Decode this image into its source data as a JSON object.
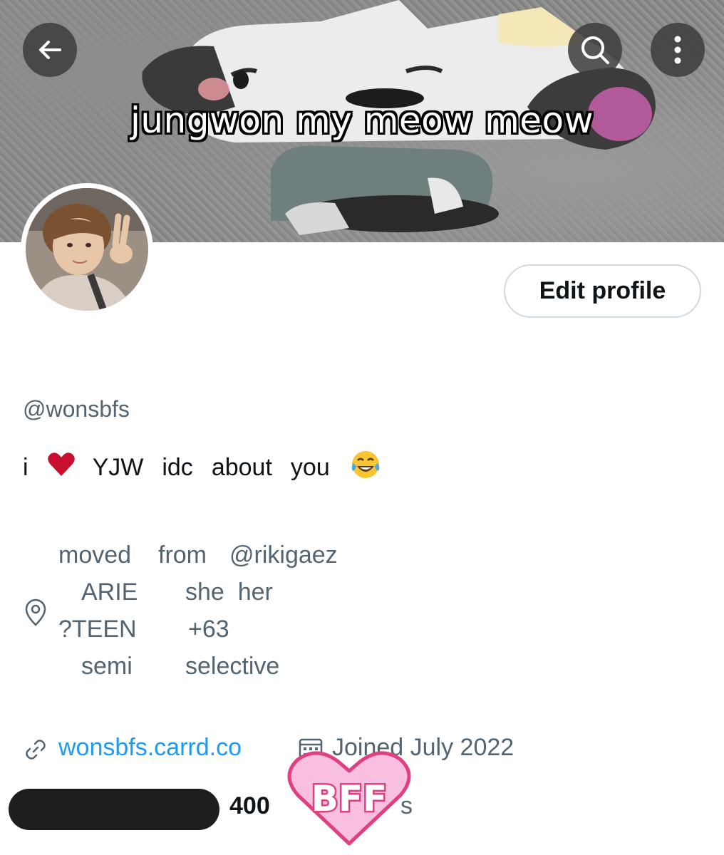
{
  "banner": {
    "caption": "jungwon my meow meow"
  },
  "header_buttons": {
    "back": "back-arrow-icon",
    "search": "search-icon",
    "more": "more-vertical-icon"
  },
  "profile": {
    "edit_button_label": "Edit profile",
    "handle": "@wonsbfs",
    "bio": {
      "word_i": "i",
      "heart_emoji": "heart-emoji",
      "word_yjw": "YJW",
      "word_idc": "idc",
      "word_about": "about",
      "word_you": "you",
      "laugh_emoji": "tears-of-joy-emoji"
    },
    "location_lines": {
      "line1_left": "moved",
      "line1_mid": "from",
      "line1_right": "@rikigaez",
      "line2_left": "ARIE",
      "line2_right": "she  her",
      "line3_left": "?TEEN",
      "line3_right": "+63",
      "line4_left": "semi",
      "line4_right": "selective"
    },
    "website": "wonsbfs.carrd.co",
    "joined": "Joined July 2022",
    "following_count": "400",
    "count_tail": "s"
  },
  "sticker": {
    "text": "BFF",
    "fill_color": "#f9bfe0",
    "outline_color": "#e0407f"
  },
  "colors": {
    "link": "#1d9bf0",
    "muted": "#536471",
    "text": "#0f1419",
    "heart": "#c8102e"
  }
}
